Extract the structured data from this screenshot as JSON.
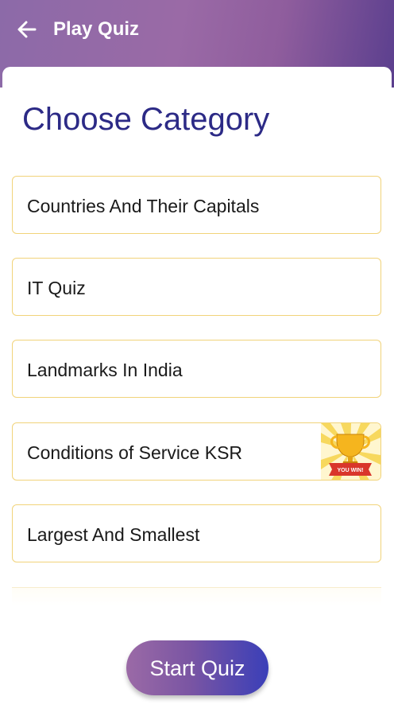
{
  "app_bar": {
    "title": "Play Quiz",
    "back_icon": "arrow-left-icon"
  },
  "page": {
    "heading": "Choose Category"
  },
  "categories": [
    {
      "label": "Countries And Their Capitals",
      "badge": false
    },
    {
      "label": "IT Quiz",
      "badge": false
    },
    {
      "label": "Landmarks In India",
      "badge": false
    },
    {
      "label": "Conditions of Service KSR",
      "badge": true,
      "badge_icon": "trophy-you-win-icon",
      "badge_text": "YOU WIN!"
    },
    {
      "label": "Largest And Smallest",
      "badge": false
    }
  ],
  "start_button": {
    "label": "Start Quiz"
  },
  "colors": {
    "header_gradient_start": "#8c6aa8",
    "header_gradient_end": "#5b3f8e",
    "heading": "#2c2a86",
    "card_border": "#f1d37a",
    "button_start": "#9b6aa6",
    "button_end": "#3a3fb8"
  }
}
